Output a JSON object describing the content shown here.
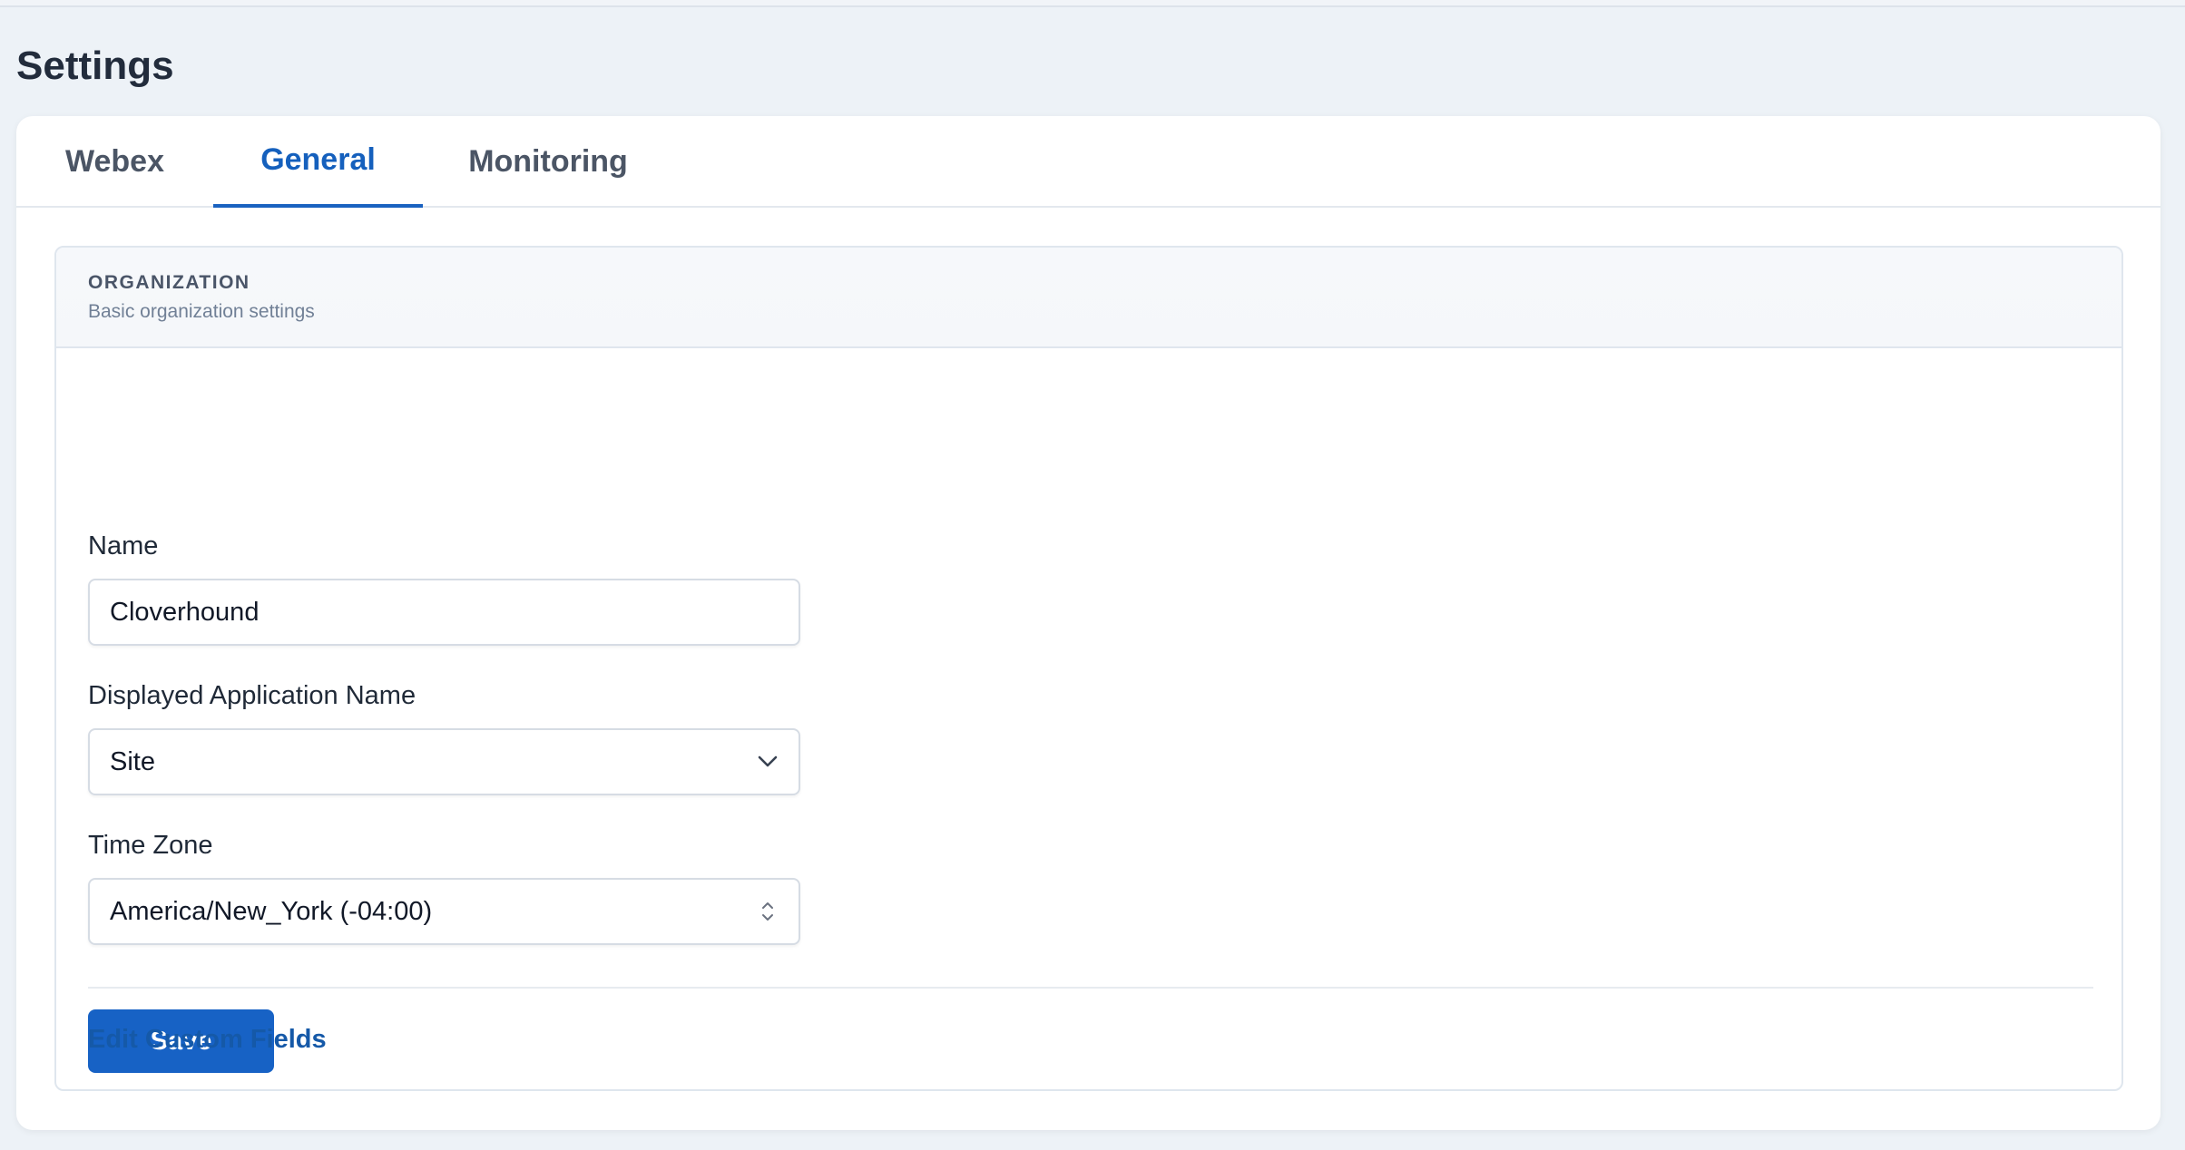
{
  "page": {
    "title": "Settings"
  },
  "tabs": [
    {
      "label": "Webex",
      "active": false
    },
    {
      "label": "General",
      "active": true
    },
    {
      "label": "Monitoring",
      "active": false
    }
  ],
  "section": {
    "title": "ORGANIZATION",
    "subtitle": "Basic organization settings"
  },
  "form": {
    "name": {
      "label": "Name",
      "value": "Cloverhound"
    },
    "app_name": {
      "label": "Displayed Application Name",
      "value": "Site"
    },
    "time_zone": {
      "label": "Time Zone",
      "value": "America/New_York (-04:00)"
    },
    "save_label": "Save"
  },
  "links": {
    "edit_custom_fields": "Edit Custom Fields"
  },
  "colors": {
    "accent": "#1762c5",
    "background": "#edf2f7",
    "link": "#1559a8"
  },
  "icons": {
    "dropdown": "chevron-down-icon",
    "select": "up-down-chevron-icon"
  }
}
